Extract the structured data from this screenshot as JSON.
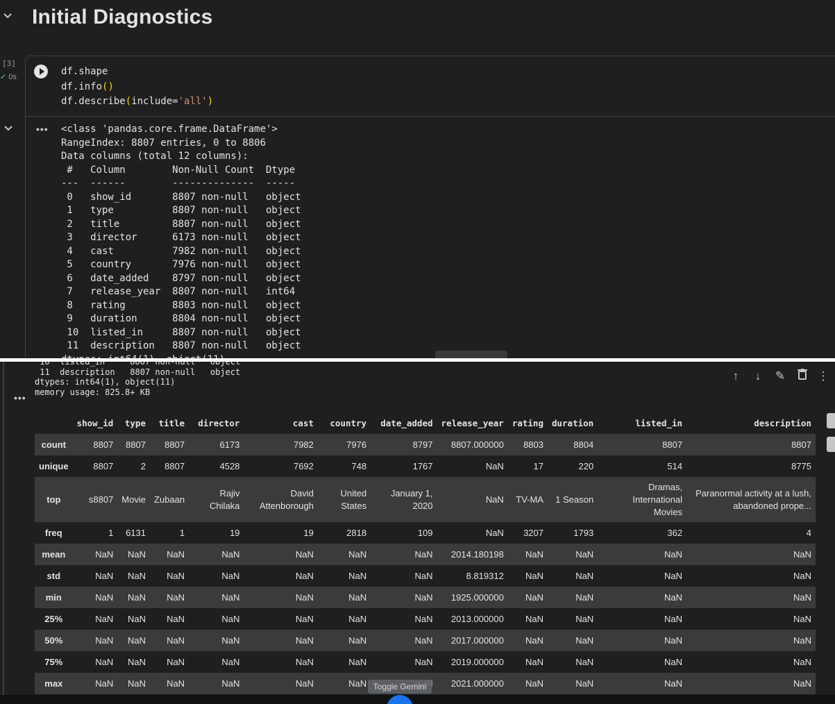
{
  "section": {
    "title": "Initial Diagnostics"
  },
  "cell": {
    "exec_count": "[3]",
    "exec_time": "0s",
    "code_line1": "df.shape",
    "code_line2_a": "df.info",
    "code_line2_b": "()",
    "code_line3_a": "df.describe",
    "code_line3_b": "(",
    "code_line3_c": "include=",
    "code_line3_d": "'all'",
    "code_line3_e": ")"
  },
  "output_top": {
    "dots": "•••",
    "text": "<class 'pandas.core.frame.DataFrame'>\nRangeIndex: 8807 entries, 0 to 8806\nData columns (total 12 columns):\n #   Column        Non-Null Count  Dtype \n---  ------        --------------  ----- \n 0   show_id       8807 non-null   object\n 1   type          8807 non-null   object\n 2   title         8807 non-null   object\n 3   director      6173 non-null   object\n 4   cast          7982 non-null   object\n 5   country       7976 non-null   object\n 6   date_added    8797 non-null   object\n 7   release_year  8807 non-null   int64 \n 8   rating        8803 non-null   object\n 9   duration      8804 non-null   object\n 10  listed_in     8807 non-null   object\n 11  description   8807 non-null   object\ndtypes: int64(1), object(11)"
  },
  "output_bottom": {
    "dots": "•••",
    "text": " 10  listed_in     8807 non-null   object\n 11  description   8807 non-null   object\ndtypes: int64(1), object(11)\nmemory usage: 825.8+ KB"
  },
  "toolbar": {
    "up_icon": "↑",
    "down_icon": "↓",
    "edit_icon": "✎",
    "delete_icon": "🗑",
    "more_icon": "⋮"
  },
  "describe_table": {
    "columns": [
      "",
      "show_id",
      "type",
      "title",
      "director",
      "cast",
      "country",
      "date_added",
      "release_year",
      "rating",
      "duration",
      "listed_in",
      "description"
    ],
    "rows": [
      {
        "label": "count",
        "cells": [
          "8807",
          "8807",
          "8807",
          "6173",
          "7982",
          "7976",
          "8797",
          "8807.000000",
          "8803",
          "8804",
          "8807",
          "8807"
        ]
      },
      {
        "label": "unique",
        "cells": [
          "8807",
          "2",
          "8807",
          "4528",
          "7692",
          "748",
          "1767",
          "NaN",
          "17",
          "220",
          "514",
          "8775"
        ]
      },
      {
        "label": "top",
        "cells": [
          "s8807",
          "Movie",
          "Zubaan",
          "Rajiv Chilaka",
          "David Attenborough",
          "United States",
          "January 1, 2020",
          "NaN",
          "TV-MA",
          "1 Season",
          "Dramas, International Movies",
          "Paranormal activity at a lush, abandoned prope..."
        ]
      },
      {
        "label": "freq",
        "cells": [
          "1",
          "6131",
          "1",
          "19",
          "19",
          "2818",
          "109",
          "NaN",
          "3207",
          "1793",
          "362",
          "4"
        ]
      },
      {
        "label": "mean",
        "cells": [
          "NaN",
          "NaN",
          "NaN",
          "NaN",
          "NaN",
          "NaN",
          "NaN",
          "2014.180198",
          "NaN",
          "NaN",
          "NaN",
          "NaN"
        ]
      },
      {
        "label": "std",
        "cells": [
          "NaN",
          "NaN",
          "NaN",
          "NaN",
          "NaN",
          "NaN",
          "NaN",
          "8.819312",
          "NaN",
          "NaN",
          "NaN",
          "NaN"
        ]
      },
      {
        "label": "min",
        "cells": [
          "NaN",
          "NaN",
          "NaN",
          "NaN",
          "NaN",
          "NaN",
          "NaN",
          "1925.000000",
          "NaN",
          "NaN",
          "NaN",
          "NaN"
        ]
      },
      {
        "label": "25%",
        "cells": [
          "NaN",
          "NaN",
          "NaN",
          "NaN",
          "NaN",
          "NaN",
          "NaN",
          "2013.000000",
          "NaN",
          "NaN",
          "NaN",
          "NaN"
        ]
      },
      {
        "label": "50%",
        "cells": [
          "NaN",
          "NaN",
          "NaN",
          "NaN",
          "NaN",
          "NaN",
          "NaN",
          "2017.000000",
          "NaN",
          "NaN",
          "NaN",
          "NaN"
        ]
      },
      {
        "label": "75%",
        "cells": [
          "NaN",
          "NaN",
          "NaN",
          "NaN",
          "NaN",
          "NaN",
          "NaN",
          "2019.000000",
          "NaN",
          "NaN",
          "NaN",
          "NaN"
        ]
      },
      {
        "label": "max",
        "cells": [
          "NaN",
          "NaN",
          "NaN",
          "NaN",
          "NaN",
          "NaN",
          "NaN",
          "2021.000000",
          "NaN",
          "NaN",
          "NaN",
          "NaN"
        ]
      }
    ]
  },
  "overlay": {
    "toggle_gemini": "Toggle Gemini"
  },
  "colors": {
    "background": "#1f1f1f",
    "row_stripe": "#3b3b3b",
    "run_ok": "#5ad17b",
    "gemini": "#1a73e8"
  }
}
